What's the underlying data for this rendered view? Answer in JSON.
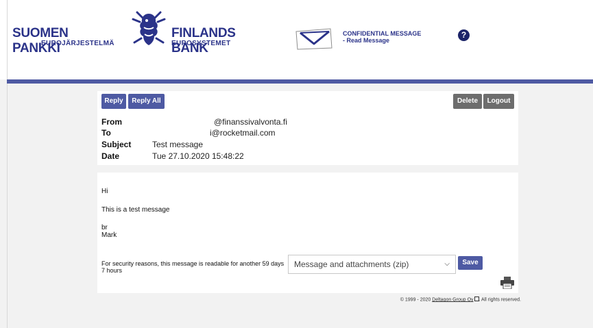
{
  "header": {
    "brand_fi": "SUOMEN PANKKI",
    "brand_fi_sub": "EUROJÄRJESTELMÄ",
    "brand_sv": "FINLANDS BANK",
    "brand_sv_sub": "EUROSYSTEMET",
    "confidential_title": "CONFIDENTIAL MESSAGE",
    "confidential_sub": "- Read Message",
    "help_label": "?"
  },
  "toolbar": {
    "reply_label": "Reply",
    "reply_all_label": "Reply All",
    "delete_label": "Delete",
    "logout_label": "Logout"
  },
  "message_header": {
    "from_label": "From",
    "from_value": "@finanssivalvonta.fi",
    "to_label": "To",
    "to_value": "i@rocketmail.com",
    "subject_label": "Subject",
    "subject_value": "Test message",
    "date_label": "Date",
    "date_value": "Tue 27.10.2020 15:48:22"
  },
  "message_body": {
    "line1": "Hi",
    "line2": "This is a test message",
    "line3": "br",
    "line4": "Mark"
  },
  "actions": {
    "security_notice": "For security reasons, this message is readable for another 59 days 7 hours",
    "download_selected": "Message and attachments (zip)",
    "save_label": "Save"
  },
  "footer": {
    "copyright_prefix": "© 1999 - 2020",
    "company_link": "Deltagon Group Oy",
    "copyright_suffix": ". All rights reserved."
  },
  "colors": {
    "brand_blue": "#2b3389",
    "button_blue": "#4e5aa3",
    "button_gray": "#6d6d6d"
  }
}
